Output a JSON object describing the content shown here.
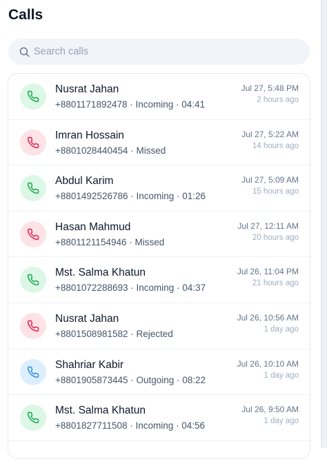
{
  "header": {
    "title": "Calls"
  },
  "search": {
    "placeholder": "Search calls",
    "value": ""
  },
  "colors": {
    "incoming_bg": "#dcf7e6",
    "incoming_fg": "#16a34a",
    "missed_bg": "#fde2e6",
    "missed_fg": "#e11d48",
    "outgoing_bg": "#dcefff",
    "outgoing_fg": "#2b8ad8"
  },
  "calls": [
    {
      "type": "incoming",
      "icon": "phone-incoming-icon",
      "name": "Nusrat Jahan",
      "detail": "+8801171892478 · Incoming · 04:41",
      "time": "Jul 27, 5:48 PM",
      "ago": "2 hours ago"
    },
    {
      "type": "missed",
      "icon": "phone-missed-icon",
      "name": "Imran Hossain",
      "detail": "+8801028440454 · Missed",
      "time": "Jul 27, 5:22 AM",
      "ago": "14 hours ago"
    },
    {
      "type": "incoming",
      "icon": "phone-incoming-icon",
      "name": "Abdul Karim",
      "detail": "+8801492526786 · Incoming · 01:26",
      "time": "Jul 27, 5:09 AM",
      "ago": "15 hours ago"
    },
    {
      "type": "missed",
      "icon": "phone-missed-icon",
      "name": "Hasan Mahmud",
      "detail": "+8801121154946 · Missed",
      "time": "Jul 27, 12:11 AM",
      "ago": "20 hours ago"
    },
    {
      "type": "incoming",
      "icon": "phone-incoming-icon",
      "name": "Mst. Salma Khatun",
      "detail": "+8801072288693 · Incoming · 04:37",
      "time": "Jul 26, 11:04 PM",
      "ago": "21 hours ago"
    },
    {
      "type": "missed",
      "icon": "phone-rejected-icon",
      "name": "Nusrat Jahan",
      "detail": "+8801508981582 · Rejected",
      "time": "Jul 26, 10:56 AM",
      "ago": "1 day ago"
    },
    {
      "type": "outgoing",
      "icon": "phone-outgoing-icon",
      "name": "Shahriar Kabir",
      "detail": "+8801905873445 · Outgoing · 08:22",
      "time": "Jul 26, 10:10 AM",
      "ago": "1 day ago"
    },
    {
      "type": "incoming",
      "icon": "phone-incoming-icon",
      "name": "Mst. Salma Khatun",
      "detail": "+8801827711508 · Incoming · 04:56",
      "time": "Jul 26, 9:50 AM",
      "ago": "1 day ago"
    }
  ]
}
